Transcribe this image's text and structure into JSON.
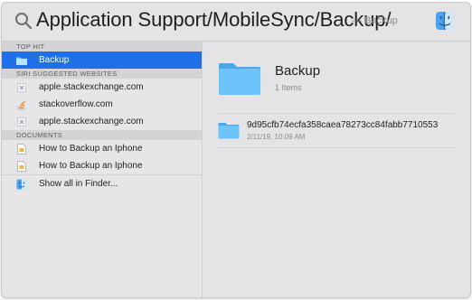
{
  "search": {
    "query": "Application Support/MobileSync/Backup/",
    "hint": "— Backup"
  },
  "sections": {
    "top_hit": "TOP HIT",
    "siri": "SIRI SUGGESTED WEBSITES",
    "documents": "DOCUMENTS"
  },
  "top_hit": {
    "label": "Backup"
  },
  "websites": [
    {
      "label": "apple.stackexchange.com",
      "icon": "stackexchange-icon"
    },
    {
      "label": "stackoverflow.com",
      "icon": "stackoverflow-icon"
    },
    {
      "label": "apple.stackexchange.com",
      "icon": "stackexchange-icon"
    }
  ],
  "documents": [
    {
      "label": "How to Backup an Iphone",
      "icon": "document-icon"
    },
    {
      "label": "How to Backup an Iphone",
      "icon": "document-icon"
    }
  ],
  "show_all": {
    "label": "Show all in Finder..."
  },
  "preview": {
    "title": "Backup",
    "subtitle": "1 Items",
    "item_name": "9d95cfb74ecfa358caea78273cc84fabb7710553",
    "item_date": "2/11/19, 10:09 AM"
  },
  "colors": {
    "selection": "#1f6fe6",
    "folder": "#5ab5f0"
  }
}
